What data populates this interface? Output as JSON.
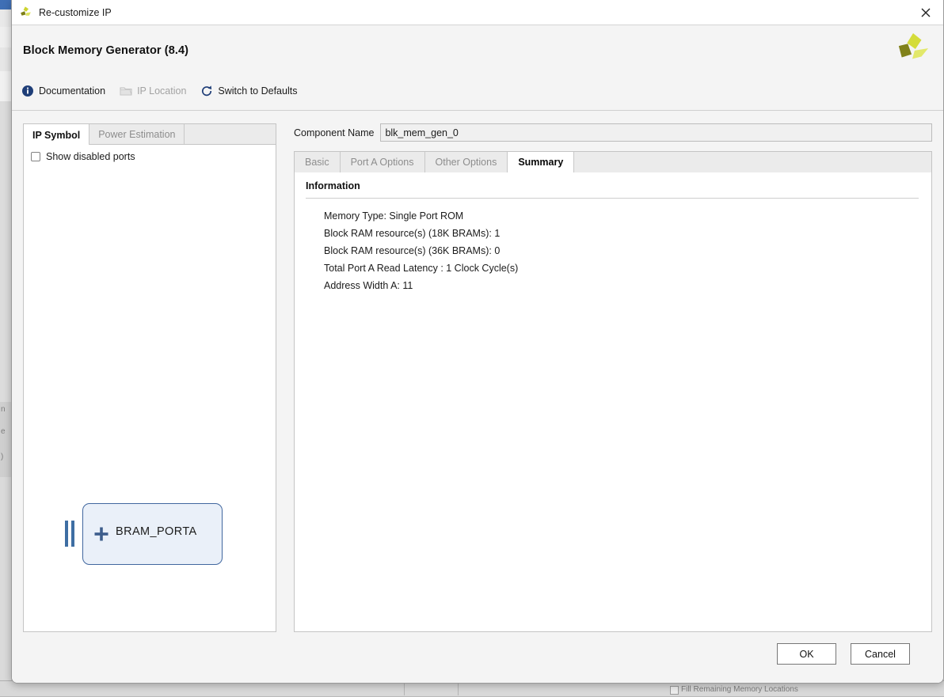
{
  "window": {
    "title": "Re-customize IP",
    "app_icon": "xilinx-logo-icon",
    "close_icon": "close-icon"
  },
  "header": {
    "page_title": "Block Memory Generator (8.4)",
    "vendor_logo": "xilinx-pinwheel-logo",
    "toolbar": [
      {
        "label": "Documentation",
        "icon": "info-icon",
        "enabled": true
      },
      {
        "label": "IP Location",
        "icon": "folder-icon",
        "enabled": false
      },
      {
        "label": "Switch to Defaults",
        "icon": "refresh-icon",
        "enabled": true
      }
    ]
  },
  "left_panel": {
    "tabs": [
      {
        "label": "IP Symbol",
        "active": true
      },
      {
        "label": "Power Estimation",
        "active": false
      }
    ],
    "show_disabled_ports": {
      "label": "Show disabled ports",
      "checked": false
    },
    "symbol": {
      "port_label": "BRAM_PORTA",
      "expander": "plus-icon",
      "box_fill": "#eaf0f9",
      "box_border": "#41679f",
      "bus_color": "#3e6ea3"
    }
  },
  "right_panel": {
    "component_name": {
      "label": "Component Name",
      "value": "blk_mem_gen_0"
    },
    "tabs": [
      {
        "label": "Basic",
        "active": false
      },
      {
        "label": "Port A Options",
        "active": false
      },
      {
        "label": "Other Options",
        "active": false
      },
      {
        "label": "Summary",
        "active": true
      }
    ],
    "information": {
      "title": "Information",
      "lines": [
        "Memory Type: Single Port ROM",
        "Block RAM resource(s) (18K BRAMs): 1",
        "Block RAM resource(s) (36K BRAMs): 0",
        "Total Port A Read Latency : 1 Clock Cycle(s)",
        "Address Width A: 11"
      ]
    }
  },
  "footer": {
    "ok_label": "OK",
    "cancel_label": "Cancel"
  },
  "background": {
    "fill_remaining_label": "Fill Remaining Memory Locations"
  }
}
